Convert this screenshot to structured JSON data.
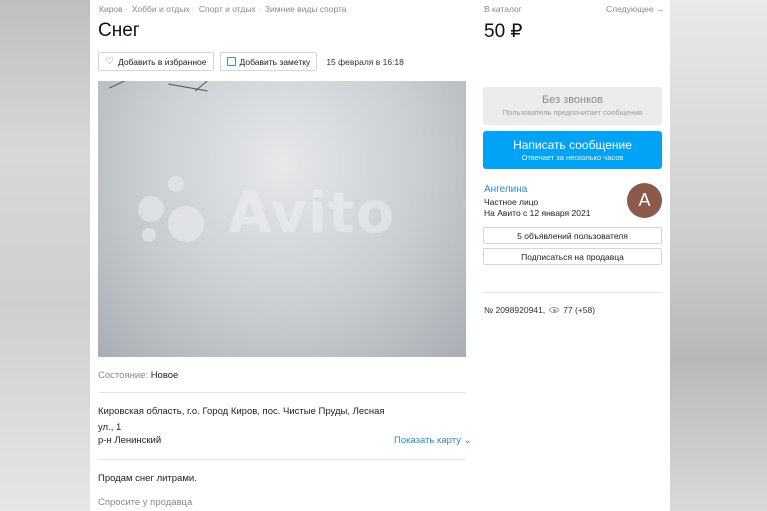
{
  "breadcrumbs": [
    "Киров",
    "Хобби и отдых",
    "Спорт и отдых",
    "Зимние виды спорта"
  ],
  "title": "Снег",
  "actions": {
    "favorite_label": "Добавить в избранное",
    "note_label": "Добавить заметку",
    "date": "15 февраля в 16:18"
  },
  "photo": {
    "watermark": "Avito"
  },
  "condition": {
    "label": "Состояние:",
    "value": "Новое"
  },
  "address": {
    "line1": "Кировская область, г.о. Город Киров, пос. Чистые Пруды, Лесная",
    "line2": "ул., 1",
    "district": "р-н Ленинский",
    "show_map": "Показать карту"
  },
  "description": "Продам снег литрами.",
  "ask_seller": "Спросите у продавца",
  "sidebar": {
    "to_catalog": "В каталог",
    "next": "Следующее →",
    "price": "50 ₽",
    "no_calls": {
      "title": "Без звонков",
      "subtitle": "Пользователь предпочитает сообщения"
    },
    "write": {
      "title": "Написать сообщение",
      "subtitle": "Отвечает за несколько часов"
    },
    "seller": {
      "name": "Ангелина",
      "type": "Частное лицо",
      "since": "На Авито с 12 января 2021",
      "avatar_letter": "А"
    },
    "ads_button": "5 объявлений пользователя",
    "subscribe_button": "Подписаться на продавца",
    "ad_number": "№ 2098920941,",
    "views": "77 (+58)"
  },
  "colors": {
    "accent": "#00a3f5",
    "link": "#2d86d2",
    "avatar": "#8b5a4a"
  }
}
